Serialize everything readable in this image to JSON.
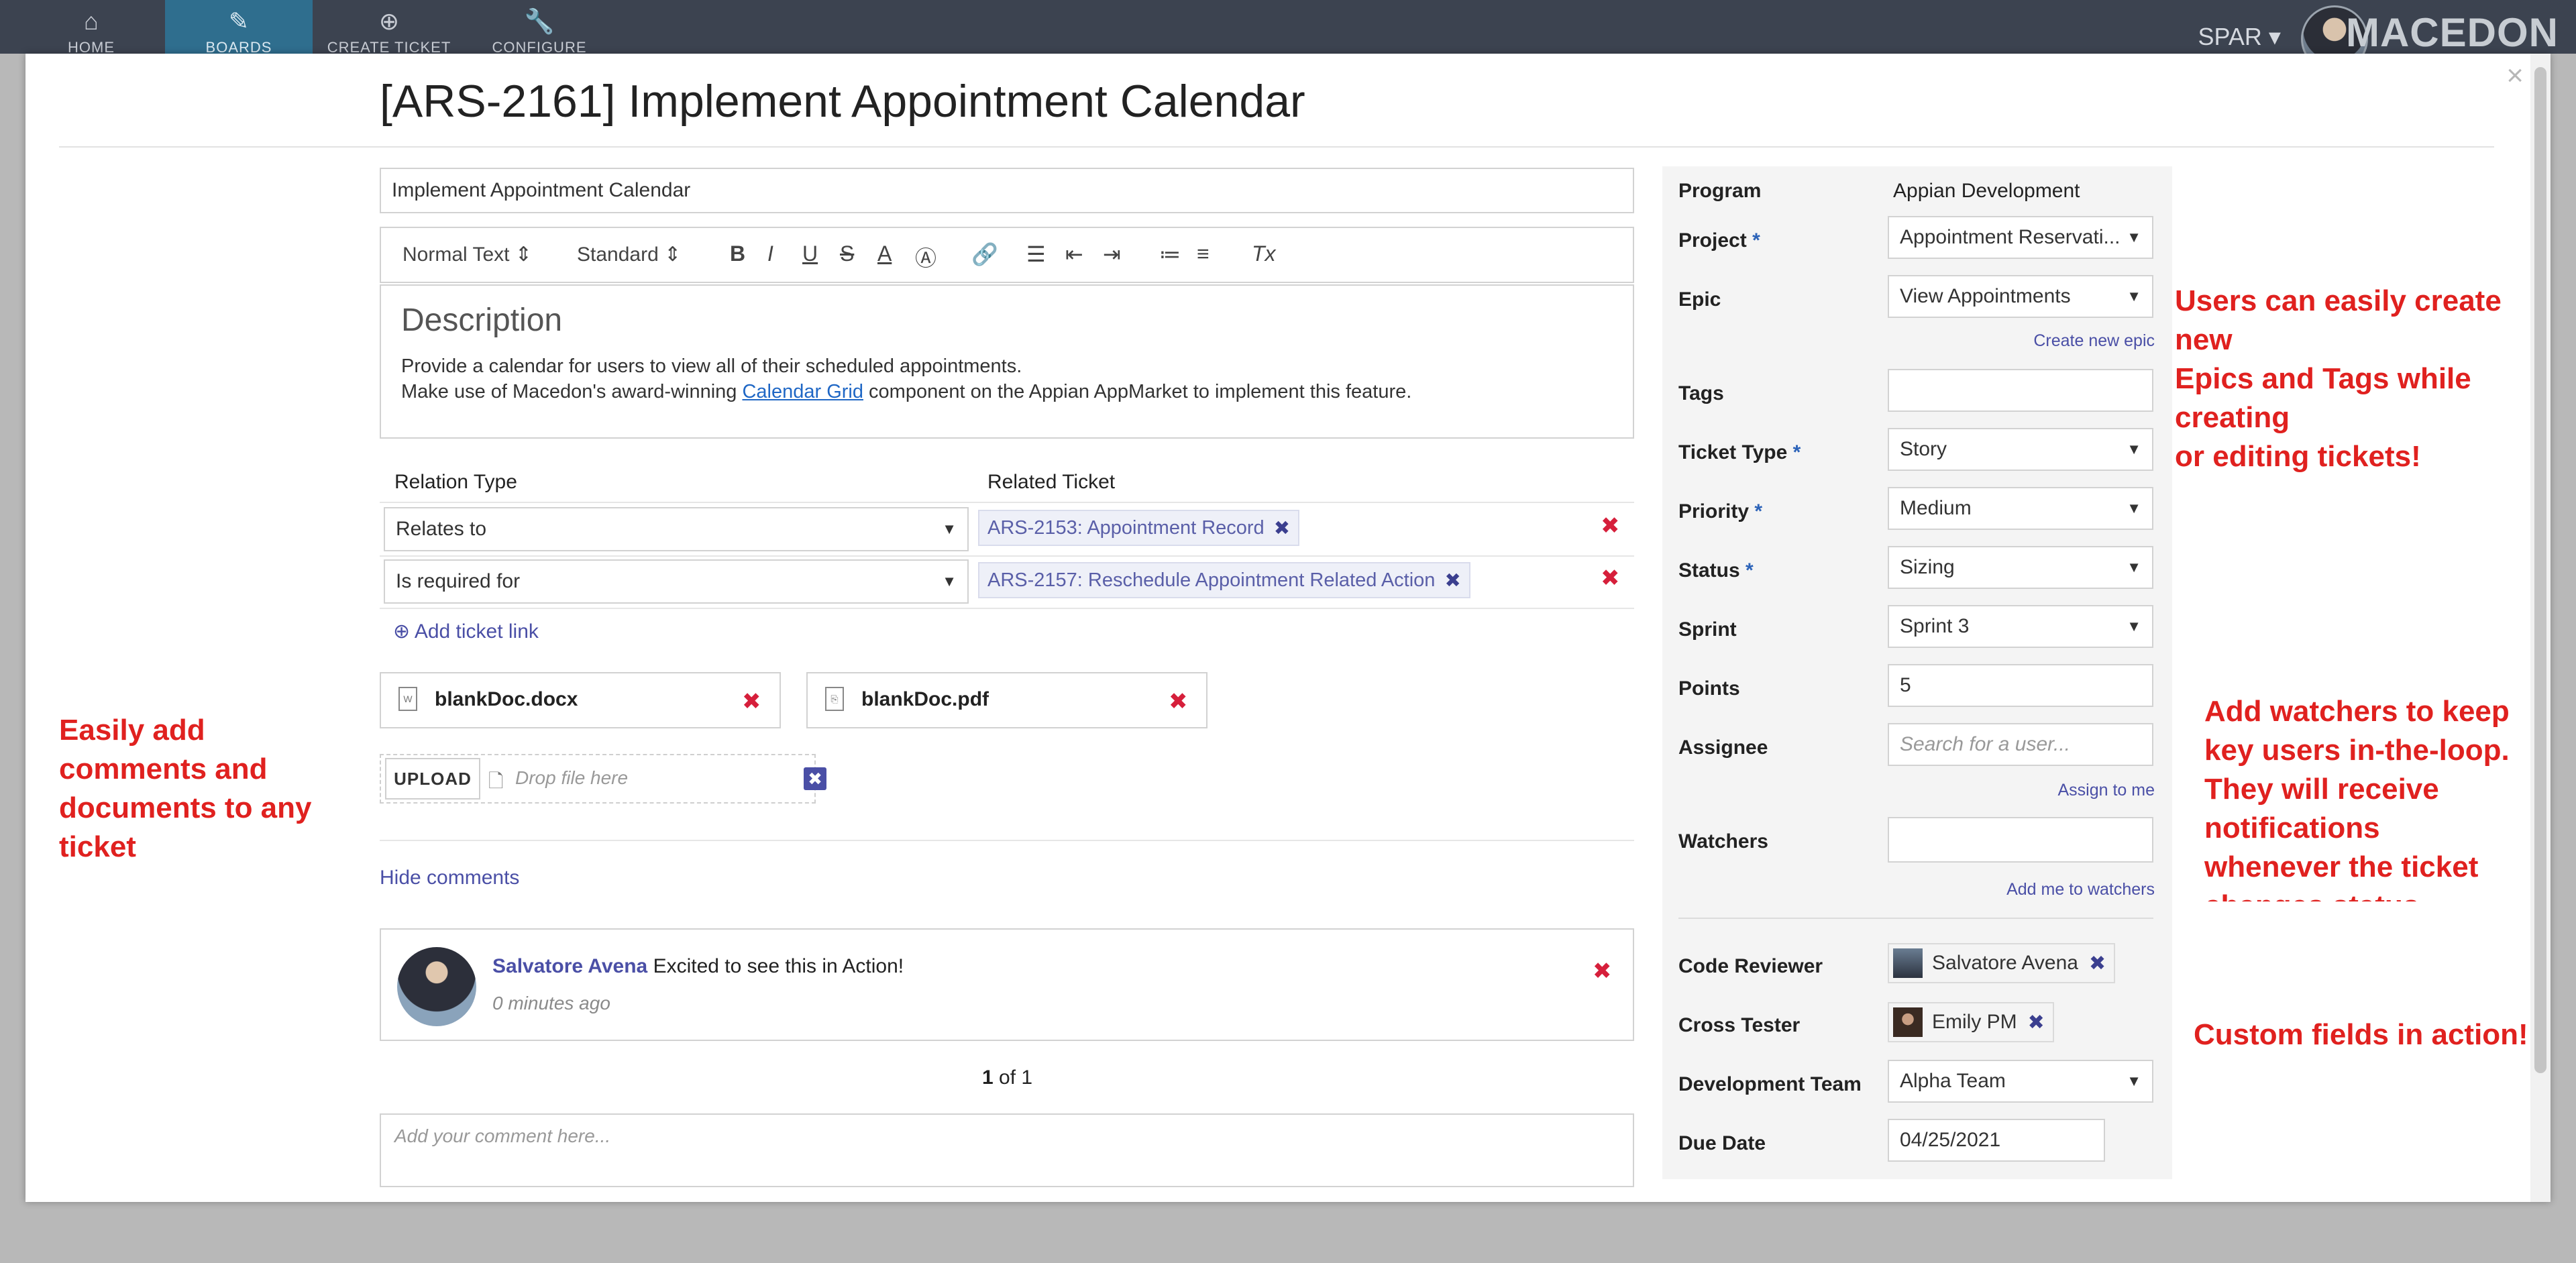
{
  "nav": {
    "items": [
      {
        "icon": "home-icon",
        "label": "HOME"
      },
      {
        "icon": "ticket-icon",
        "label": "BOARDS"
      },
      {
        "icon": "plus-circle-icon",
        "label": "CREATE TICKET"
      },
      {
        "icon": "wrench-icon",
        "label": "CONFIGURE"
      }
    ],
    "user": "SPAR",
    "brand": "MACEDON"
  },
  "modal": {
    "close_icon": "×",
    "title": "[ARS-2161] Implement Appointment Calendar",
    "summary_value": "Implement Appointment Calendar",
    "editor": {
      "style": "Normal Text",
      "size": "Standard",
      "heading": "Description",
      "line1": "Provide a calendar for users to view all of their scheduled appointments.",
      "line2_pre": "Make use of Macedon's award-winning ",
      "line2_link": "Calendar Grid",
      "line2_post": " component on the Appian AppMarket to implement this feature."
    },
    "relations": {
      "header_type": "Relation Type",
      "header_ticket": "Related Ticket",
      "rows": [
        {
          "type": "Relates to",
          "ticket": "ARS-2153: Appointment Record"
        },
        {
          "type": "Is required for",
          "ticket": "ARS-2157: Reschedule Appointment Related Action"
        }
      ],
      "add_link": "Add ticket link"
    },
    "files": [
      {
        "name": "blankDoc.docx",
        "icon": "word-doc-icon"
      },
      {
        "name": "blankDoc.pdf",
        "icon": "pdf-doc-icon"
      }
    ],
    "upload": {
      "button": "UPLOAD",
      "placeholder": "Drop file here"
    },
    "hide_comments": "Hide comments",
    "comment": {
      "author": "Salvatore Avena",
      "text": "Excited to see this in Action!",
      "time": "0 minutes ago"
    },
    "pager": {
      "current": "1",
      "of_text": "of 1"
    },
    "comment_placeholder": "Add your comment here..."
  },
  "fields": {
    "program_label": "Program",
    "program_value": "Appian Development",
    "project_label": "Project",
    "project_value": "Appointment Reservati...",
    "epic_label": "Epic",
    "epic_value": "View Appointments",
    "create_epic": "Create new epic",
    "tags_label": "Tags",
    "type_label": "Ticket Type",
    "type_value": "Story",
    "priority_label": "Priority",
    "priority_value": "Medium",
    "status_label": "Status",
    "status_value": "Sizing",
    "sprint_label": "Sprint",
    "sprint_value": "Sprint 3",
    "points_label": "Points",
    "points_value": "5",
    "assignee_label": "Assignee",
    "assignee_placeholder": "Search for a user...",
    "assign_me": "Assign to me",
    "watchers_label": "Watchers",
    "add_watchers": "Add me to watchers",
    "reviewer_label": "Code Reviewer",
    "reviewer_value": "Salvatore Avena",
    "tester_label": "Cross Tester",
    "tester_value": "Emily PM",
    "team_label": "Development Team",
    "team_value": "Alpha Team",
    "due_label": "Due Date",
    "due_value": "04/25/2021",
    "required_mark": "*"
  },
  "annotations": {
    "epics_tags": [
      "Users can easily create new",
      "Epics and Tags while creating",
      "or editing tickets!"
    ],
    "watchers": [
      "Add watchers to keep",
      "key users in-the-loop.",
      "They will receive",
      "notifications",
      "whenever the ticket",
      "changes status."
    ],
    "custom": "Custom fields in action!",
    "comments": [
      "Easily add",
      "comments and",
      "documents to any",
      "ticket"
    ]
  },
  "colors": {
    "accent": "#4a4fa6",
    "delete": "#d61f3b",
    "annotation": "#e0211f",
    "nav": "#3c4350"
  }
}
